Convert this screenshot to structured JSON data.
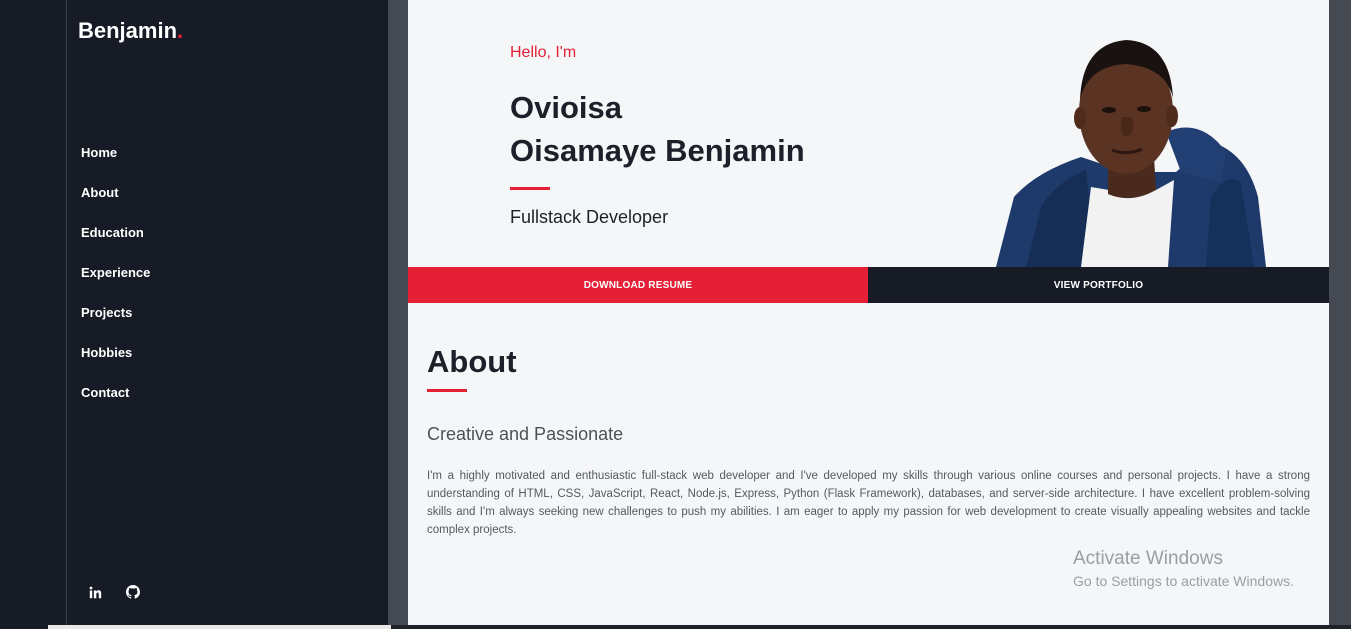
{
  "sidebar": {
    "brand": "Benjamin",
    "brand_dot": ".",
    "nav": [
      "Home",
      "About",
      "Education",
      "Experience",
      "Projects",
      "Hobbies",
      "Contact"
    ],
    "social": [
      "linkedin-icon",
      "github-icon"
    ]
  },
  "hero": {
    "greeting": "Hello, I'm",
    "name_line1": "Ovioisa",
    "name_line2": "Oisamaye Benjamin",
    "role": "Fullstack Developer",
    "resume_button": "DOWNLOAD RESUME",
    "portfolio_button": "VIEW PORTFOLIO"
  },
  "about": {
    "title": "About",
    "subtitle": "Creative and Passionate",
    "body": "I'm a highly motivated and enthusiastic full-stack web developer and I've developed my skills through various online courses and personal projects. I have a strong understanding of HTML, CSS, JavaScript, React, Node.js, Express, Python (Flask Framework), databases, and server-side architecture. I have excellent problem-solving skills and I'm always seeking new challenges to push my abilities. I am eager to apply my passion for web development to create visually appealing websites and tackle complex projects."
  },
  "watermark": {
    "line1": "Activate Windows",
    "line2": "Go to Settings to activate Windows."
  },
  "colors": {
    "accent": "#e51f35",
    "sidebar": "#161b25",
    "background": "#f5f6f8"
  }
}
